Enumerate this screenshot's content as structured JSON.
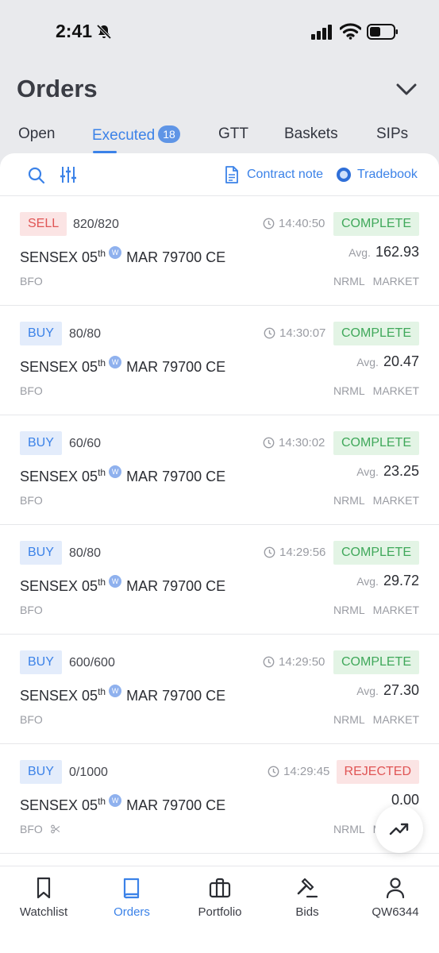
{
  "status_bar": {
    "time": "2:41"
  },
  "header": {
    "title": "Orders"
  },
  "tabs": [
    {
      "label": "Open"
    },
    {
      "label": "Executed",
      "badge": "18"
    },
    {
      "label": "GTT"
    },
    {
      "label": "Baskets"
    },
    {
      "label": "SIPs"
    }
  ],
  "toolbar": {
    "contract_note": "Contract note",
    "tradebook": "Tradebook"
  },
  "common": {
    "avg_label": "Avg.",
    "weekly_badge": "W"
  },
  "orders": [
    {
      "side": "SELL",
      "qty": "820/820",
      "time": "14:40:50",
      "status": "COMPLETE",
      "instrument_prefix": "SENSEX 05",
      "instrument_sup": "th",
      "instrument_suffix": "MAR 79700 CE",
      "avg": "162.93",
      "exchange": "BFO",
      "product": "NRML",
      "order_type": "MARKET"
    },
    {
      "side": "BUY",
      "qty": "80/80",
      "time": "14:30:07",
      "status": "COMPLETE",
      "instrument_prefix": "SENSEX 05",
      "instrument_sup": "th",
      "instrument_suffix": "MAR 79700 CE",
      "avg": "20.47",
      "exchange": "BFO",
      "product": "NRML",
      "order_type": "MARKET"
    },
    {
      "side": "BUY",
      "qty": "60/60",
      "time": "14:30:02",
      "status": "COMPLETE",
      "instrument_prefix": "SENSEX 05",
      "instrument_sup": "th",
      "instrument_suffix": "MAR 79700 CE",
      "avg": "23.25",
      "exchange": "BFO",
      "product": "NRML",
      "order_type": "MARKET"
    },
    {
      "side": "BUY",
      "qty": "80/80",
      "time": "14:29:56",
      "status": "COMPLETE",
      "instrument_prefix": "SENSEX 05",
      "instrument_sup": "th",
      "instrument_suffix": "MAR 79700 CE",
      "avg": "29.72",
      "exchange": "BFO",
      "product": "NRML",
      "order_type": "MARKET"
    },
    {
      "side": "BUY",
      "qty": "600/600",
      "time": "14:29:50",
      "status": "COMPLETE",
      "instrument_prefix": "SENSEX 05",
      "instrument_sup": "th",
      "instrument_suffix": "MAR 79700 CE",
      "avg": "27.30",
      "exchange": "BFO",
      "product": "NRML",
      "order_type": "MARKET"
    },
    {
      "side": "BUY",
      "qty": "0/1000",
      "time": "14:29:45",
      "status": "REJECTED",
      "instrument_prefix": "SENSEX 05",
      "instrument_sup": "th",
      "instrument_suffix": "MAR 79700 CE",
      "avg": "0.00",
      "exchange": "BFO",
      "product": "NRML",
      "order_type": "MARKET"
    }
  ],
  "bottom_nav": [
    {
      "label": "Watchlist",
      "icon": "bookmark-icon"
    },
    {
      "label": "Orders",
      "icon": "book-icon"
    },
    {
      "label": "Portfolio",
      "icon": "briefcase-icon"
    },
    {
      "label": "Bids",
      "icon": "gavel-icon"
    },
    {
      "label": "QW6344",
      "icon": "user-icon"
    }
  ],
  "colors": {
    "accent": "#3b82e8",
    "complete": "#3fa85a",
    "sell_rejected": "#e05555"
  }
}
